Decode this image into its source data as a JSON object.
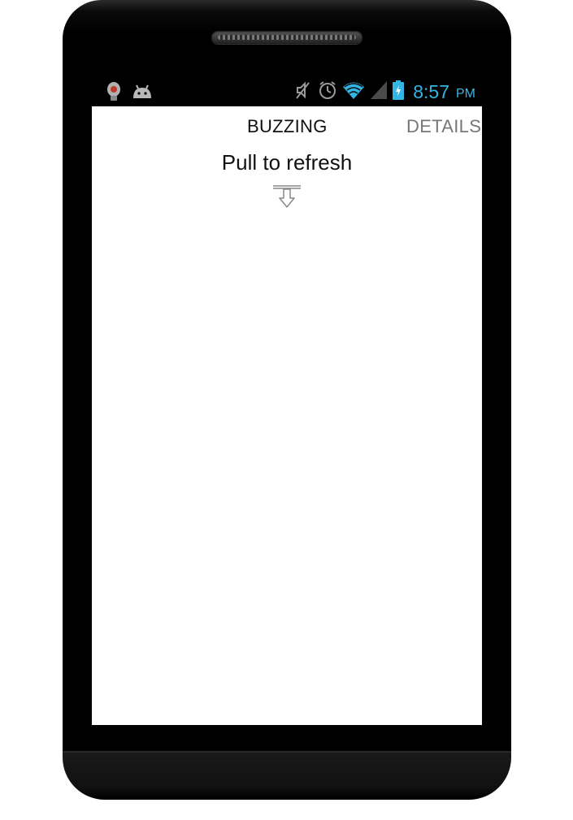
{
  "status_bar": {
    "time": "8:57",
    "ampm": "PM",
    "icons_left": [
      "app-notification-icon",
      "android-icon"
    ],
    "icons_right": [
      "muted-icon",
      "alarm-icon",
      "wifi-icon",
      "signal-icon",
      "battery-charging-icon"
    ],
    "accent_color": "#33b5e5"
  },
  "tabs": [
    {
      "label": "BUZZING",
      "active": true
    },
    {
      "label": "DETAILS",
      "active": false
    }
  ],
  "main": {
    "pull_to_refresh_label": "Pull to refresh",
    "pull_icon": "pull-down-arrow-icon"
  }
}
